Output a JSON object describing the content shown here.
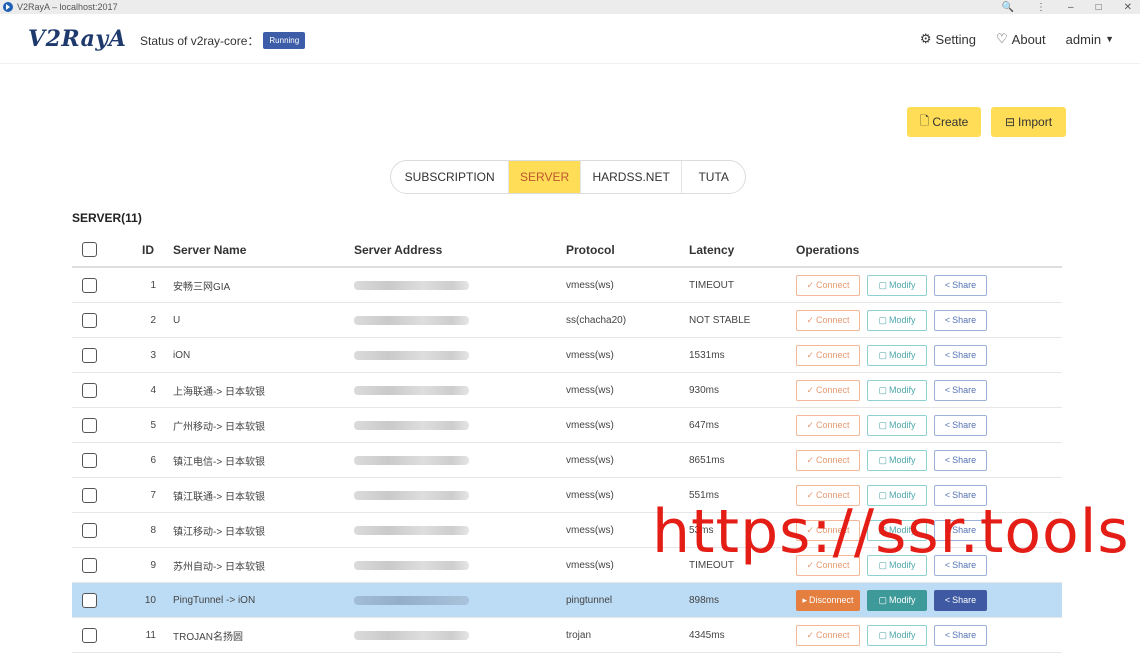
{
  "window": {
    "title": "V2RayA – localhost:2017",
    "controls": [
      "🔍",
      "⋮",
      "–",
      "□",
      "✕"
    ]
  },
  "header": {
    "logo": "V2RayA",
    "core_status_label": "Status of v2ray-core：",
    "core_status_badge": "Running",
    "nav": {
      "setting": "Setting",
      "about": "About",
      "user": "admin"
    }
  },
  "actions": {
    "create": "Create",
    "import": "Import"
  },
  "tabs": [
    {
      "label": "SUBSCRIPTION"
    },
    {
      "label": "SERVER"
    },
    {
      "label": "HARDSS.NET"
    },
    {
      "label": "TUTA"
    }
  ],
  "section_title": "SERVER(11)",
  "table": {
    "headers": {
      "id": "ID",
      "name": "Server Name",
      "address": "Server Address",
      "protocol": "Protocol",
      "latency": "Latency",
      "operations": "Operations"
    },
    "rows": [
      {
        "id": "1",
        "name": "安畅三网GIA",
        "protocol": "vmess(ws)",
        "latency": "TIMEOUT",
        "connect": "Connect",
        "modify": "Modify",
        "share": "Share"
      },
      {
        "id": "2",
        "name": "U",
        "protocol": "ss(chacha20)",
        "latency": "NOT STABLE",
        "connect": "Connect",
        "modify": "Modify",
        "share": "Share"
      },
      {
        "id": "3",
        "name": "iON",
        "protocol": "vmess(ws)",
        "latency": "1531ms",
        "connect": "Connect",
        "modify": "Modify",
        "share": "Share"
      },
      {
        "id": "4",
        "name": "上海联通-> 日本软银",
        "protocol": "vmess(ws)",
        "latency": "930ms",
        "connect": "Connect",
        "modify": "Modify",
        "share": "Share"
      },
      {
        "id": "5",
        "name": "广州移动-> 日本软银",
        "protocol": "vmess(ws)",
        "latency": "647ms",
        "connect": "Connect",
        "modify": "Modify",
        "share": "Share"
      },
      {
        "id": "6",
        "name": "镇江电信-> 日本软银",
        "protocol": "vmess(ws)",
        "latency": "8651ms",
        "connect": "Connect",
        "modify": "Modify",
        "share": "Share"
      },
      {
        "id": "7",
        "name": "镇江联通-> 日本软银",
        "protocol": "vmess(ws)",
        "latency": "551ms",
        "connect": "Connect",
        "modify": "Modify",
        "share": "Share"
      },
      {
        "id": "8",
        "name": "镇江移动-> 日本软银",
        "protocol": "vmess(ws)",
        "latency": "53ms",
        "connect": "Connect",
        "modify": "Modify",
        "share": "Share"
      },
      {
        "id": "9",
        "name": "苏州自动-> 日本软银",
        "protocol": "vmess(ws)",
        "latency": "TIMEOUT",
        "connect": "Connect",
        "modify": "Modify",
        "share": "Share"
      },
      {
        "id": "10",
        "name": "PingTunnel -> iON",
        "protocol": "pingtunnel",
        "latency": "898ms",
        "connect": "Disconnect",
        "modify": "Modify",
        "share": "Share",
        "selected": true
      },
      {
        "id": "11",
        "name": "TROJAN名扬圆",
        "protocol": "trojan",
        "latency": "4345ms",
        "connect": "Connect",
        "modify": "Modify",
        "share": "Share"
      }
    ]
  },
  "watermark": "https://ssr.tools",
  "colors": {
    "accent_yellow": "#ffdd57",
    "badge_blue": "#3d5da8",
    "selected_row": "#bcdcf5",
    "connect_orange": "#e47f3f",
    "modify_teal": "#3d9a99",
    "share_blue": "#3f5aa3"
  }
}
